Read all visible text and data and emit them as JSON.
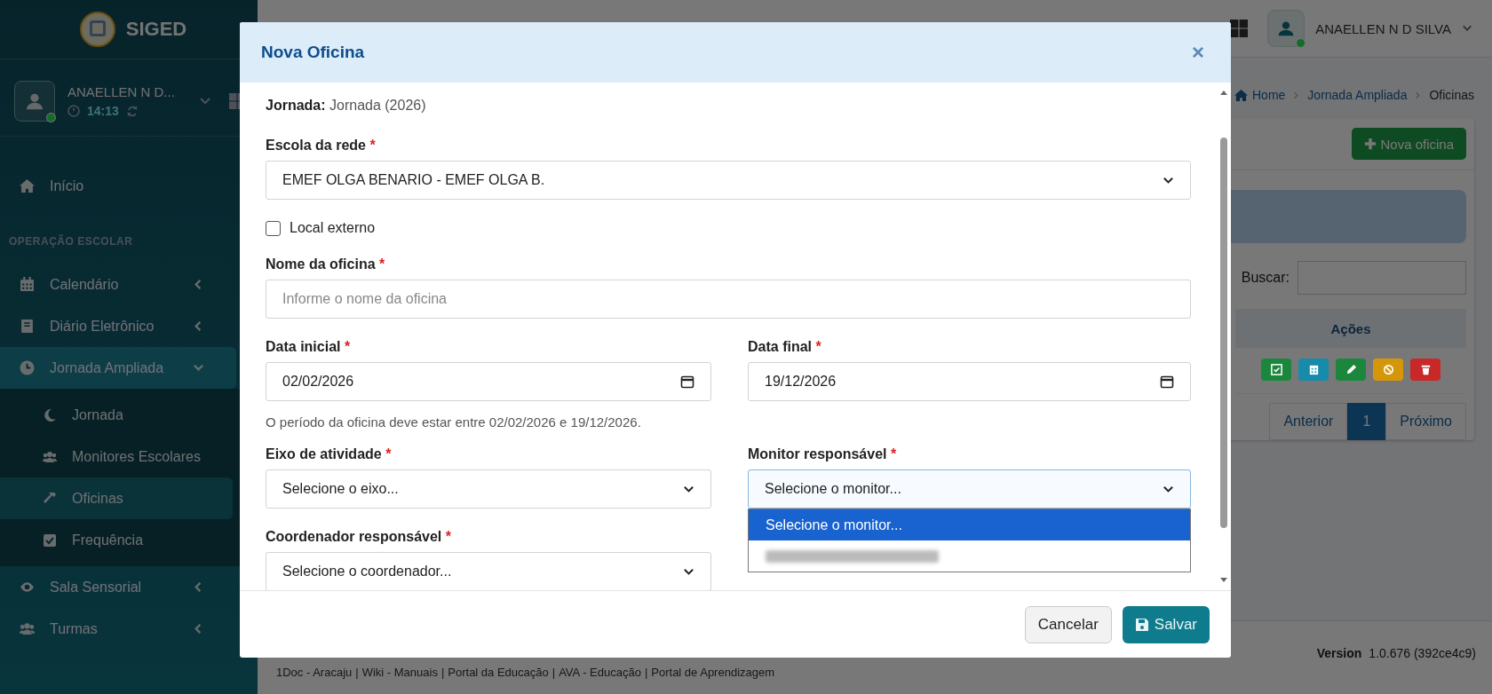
{
  "sidebar": {
    "brand": "SIGED",
    "user": {
      "name": "ANAELLEN N D...",
      "time": "14:13"
    },
    "items": [
      {
        "kind": "link",
        "label": "Início",
        "selected": false
      },
      {
        "kind": "header",
        "label": "OPERAÇÃO ESCOLAR"
      },
      {
        "kind": "menu",
        "label": "Calendário",
        "selected": false,
        "expanded": false
      },
      {
        "kind": "menu",
        "label": "Diário Eletrônico",
        "selected": false,
        "expanded": false
      },
      {
        "kind": "menu",
        "label": "Jornada Ampliada",
        "selected": false,
        "expanded": true,
        "children": [
          {
            "label": "Jornada",
            "selected": false
          },
          {
            "label": "Monitores Escolares",
            "selected": false
          },
          {
            "label": "Oficinas",
            "selected": true
          },
          {
            "label": "Frequência",
            "selected": false
          }
        ]
      },
      {
        "kind": "menu",
        "label": "Sala Sensorial",
        "selected": false,
        "expanded": false
      },
      {
        "kind": "menu",
        "label": "Turmas",
        "selected": false,
        "expanded": false
      }
    ]
  },
  "topbar": {
    "user_name": "ANAELLEN N D SILVA"
  },
  "page": {
    "breadcrumb": [
      "Home",
      "Jornada Ampliada",
      "Oficinas"
    ],
    "new_button": "Nova oficina",
    "search_label": "Buscar:",
    "actions_column": "Ações",
    "action_buttons": [
      {
        "color": "#1b873c"
      },
      {
        "color": "#178baa"
      },
      {
        "color": "#1b873c"
      },
      {
        "color": "#d6960a"
      },
      {
        "color": "#c82828"
      }
    ],
    "pagination": [
      {
        "label": "Anterior",
        "selected": false
      },
      {
        "label": "1",
        "selected": true
      },
      {
        "label": "Próximo",
        "selected": false
      }
    ]
  },
  "footer": {
    "separator": "|",
    "links": [
      "1Doc - Aracaju",
      "Wiki - Manuais",
      "Portal da Educação",
      "AVA - Educação",
      "Portal de Aprendizagem"
    ],
    "version_label": "Version",
    "version": "1.0.676 (392ce4c9)"
  },
  "modal": {
    "title": "Nova Oficina",
    "close": "×",
    "jornada_label": "Jornada:",
    "jornada_value": "Jornada (2026)",
    "rows": [
      [
        {
          "kind": "select",
          "label": "Escola da rede",
          "required_mark": "*",
          "value": "EMEF OLGA BENARIO - EMEF OLGA B."
        }
      ],
      [
        {
          "kind": "checkbox",
          "label": "Local externo",
          "checked": false
        }
      ],
      [
        {
          "kind": "text",
          "label": "Nome da oficina",
          "required_mark": "*",
          "placeholder": "Informe o nome da oficina"
        }
      ],
      [
        {
          "kind": "date",
          "label": "Data inicial",
          "required_mark": "*",
          "value": "02/02/2026"
        },
        {
          "kind": "date",
          "label": "Data final",
          "required_mark": "*",
          "value": "19/12/2026"
        }
      ],
      [
        {
          "kind": "help",
          "text": "O período da oficina deve estar entre 02/02/2026 e 19/12/2026."
        }
      ],
      [
        {
          "kind": "select",
          "label": "Eixo de atividade",
          "required_mark": "*",
          "value": "Selecione o eixo..."
        },
        {
          "kind": "select",
          "label": "Monitor responsável",
          "required_mark": "*",
          "value": "Selecione o monitor...",
          "expanded": true,
          "options": [
            {
              "kind": "text",
              "label": "Selecione o monitor...",
              "selected": true
            },
            {
              "kind": "redacted",
              "selected": false
            }
          ]
        }
      ],
      [
        {
          "kind": "select",
          "label": "Coordenador responsável",
          "required_mark": "*",
          "value": "Selecione o coordenador..."
        }
      ]
    ],
    "buttons": [
      {
        "kind": "secondary",
        "label": "Cancelar"
      },
      {
        "kind": "primary",
        "label": "Salvar"
      }
    ]
  }
}
